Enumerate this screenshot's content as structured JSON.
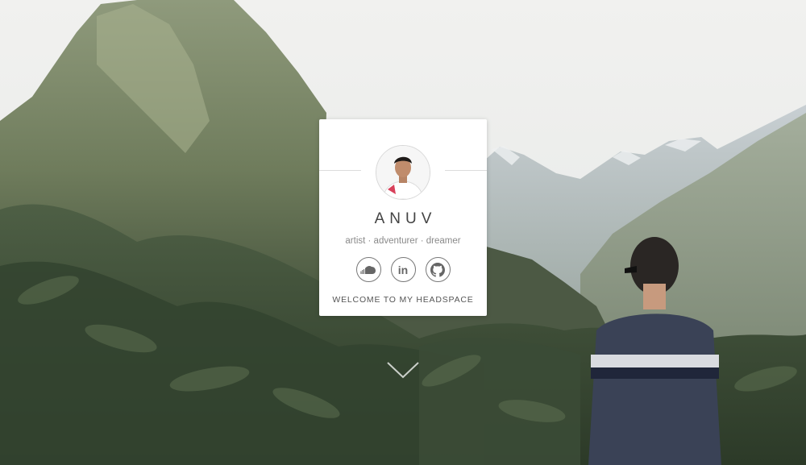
{
  "profile": {
    "name": "ANUV",
    "tagline": "artist · adventurer · dreamer",
    "welcome_label": "WELCOME TO MY HEADSPACE"
  },
  "social_links": [
    {
      "icon": "soundcloud-icon"
    },
    {
      "icon": "linkedin-icon",
      "glyph": "in"
    },
    {
      "icon": "github-icon"
    }
  ],
  "scroll_indicator": {
    "icon": "chevron-down-icon"
  },
  "colors": {
    "card_bg": "#ffffff",
    "text_primary": "#444444",
    "text_secondary": "#8a8a8a",
    "icon_stroke": "#777777"
  }
}
